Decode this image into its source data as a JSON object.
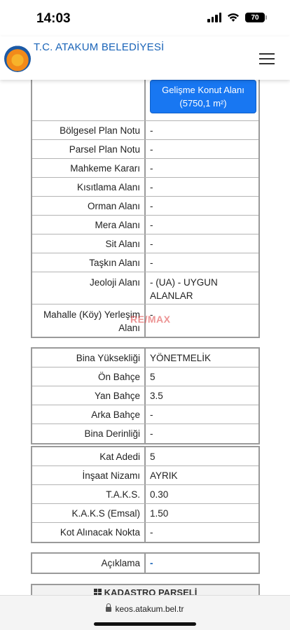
{
  "status_bar": {
    "time": "14:03",
    "battery": "70"
  },
  "header": {
    "title": "T.C. ATAKUM BELEDİYESİ"
  },
  "table1": {
    "zone_button": [
      "Gelişme Konut Alanı",
      "(5750,1 m²)"
    ],
    "rows": [
      {
        "label": "Bölgesel Plan Notu",
        "value": "-"
      },
      {
        "label": "Parsel Plan Notu",
        "value": "-"
      },
      {
        "label": "Mahkeme Kararı",
        "value": "-"
      },
      {
        "label": "Kısıtlama Alanı",
        "value": "-"
      },
      {
        "label": "Orman Alanı",
        "value": "-"
      },
      {
        "label": "Mera Alanı",
        "value": "-"
      },
      {
        "label": "Sit Alanı",
        "value": "-"
      },
      {
        "label": "Taşkın Alanı",
        "value": "-"
      },
      {
        "label": [
          "Jeoloji Alanı"
        ],
        "value": [
          "- (UA) - UYGUN",
          "ALANLAR"
        ]
      },
      {
        "label": [
          "Mahalle (Köy) Yerleşim",
          "Alanı"
        ],
        "value": [
          "-"
        ]
      }
    ]
  },
  "table2": {
    "rows": [
      {
        "label": "Bina Yüksekliği",
        "value": "YÖNETMELİK"
      },
      {
        "label": "Ön Bahçe",
        "value": "5"
      },
      {
        "label": "Yan Bahçe",
        "value": "3.5"
      },
      {
        "label": "Arka Bahçe",
        "value": "-"
      },
      {
        "label": "Bina Derinliği",
        "value": "-"
      }
    ]
  },
  "table3": {
    "rows": [
      {
        "label": "Kat Adedi",
        "value": "5"
      },
      {
        "label": "İnşaat Nizamı",
        "value": "AYRIK"
      },
      {
        "label": "T.A.K.S.",
        "value": "0.30"
      },
      {
        "label": "K.A.K.S (Emsal)",
        "value": "1.50"
      },
      {
        "label": "Kot Alınacak Nokta",
        "value": "-"
      }
    ]
  },
  "table4": {
    "rows": [
      {
        "label": "Açıklama",
        "value": "-"
      }
    ]
  },
  "section": {
    "title": "KADASTRO PARSELİ"
  },
  "watermark": "RE/MAX",
  "browser": {
    "url": "keos.atakum.bel.tr"
  }
}
